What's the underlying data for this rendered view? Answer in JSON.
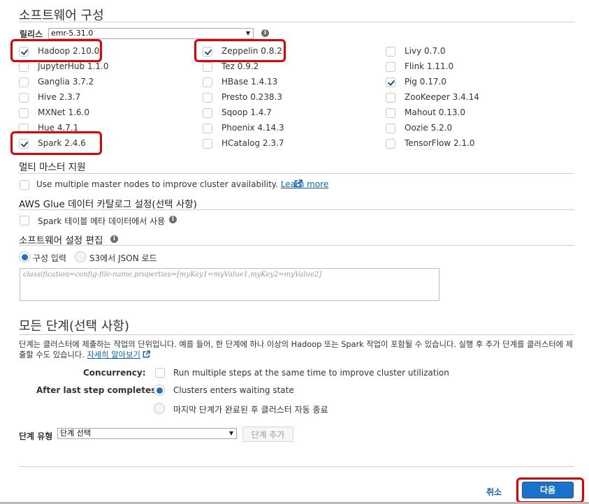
{
  "software": {
    "title": "소프트웨어 구성",
    "release_label": "릴리스",
    "release_value": "emr-5.31.0",
    "apps": [
      {
        "label": "Hadoop 2.10.0",
        "checked": true
      },
      {
        "label": "Zeppelin 0.8.2",
        "checked": true
      },
      {
        "label": "Livy 0.7.0",
        "checked": false
      },
      {
        "label": "JupyterHub 1.1.0",
        "checked": false
      },
      {
        "label": "Tez 0.9.2",
        "checked": false
      },
      {
        "label": "Flink 1.11.0",
        "checked": false
      },
      {
        "label": "Ganglia 3.7.2",
        "checked": false
      },
      {
        "label": "HBase 1.4.13",
        "checked": false
      },
      {
        "label": "Pig 0.17.0",
        "checked": true
      },
      {
        "label": "Hive 2.3.7",
        "checked": false
      },
      {
        "label": "Presto 0.238.3",
        "checked": false
      },
      {
        "label": "ZooKeeper 3.4.14",
        "checked": false
      },
      {
        "label": "MXNet 1.6.0",
        "checked": false
      },
      {
        "label": "Sqoop 1.4.7",
        "checked": false
      },
      {
        "label": "Mahout 0.13.0",
        "checked": false
      },
      {
        "label": "Hue 4.7.1",
        "checked": false
      },
      {
        "label": "Phoenix 4.14.3",
        "checked": false
      },
      {
        "label": "Oozie 5.2.0",
        "checked": false
      },
      {
        "label": "Spark 2.4.6",
        "checked": true
      },
      {
        "label": "HCatalog 2.3.7",
        "checked": false
      },
      {
        "label": "TensorFlow 2.1.0",
        "checked": false
      }
    ]
  },
  "multi_master": {
    "title": "멀티 마스터 지원",
    "checkbox_label": "Use multiple master nodes to improve cluster availability.",
    "learn_more": "Learn more"
  },
  "glue": {
    "title": "AWS Glue 데이터 카탈로그 설정(선택 사항)",
    "checkbox_label": "Spark 테이블 메타 데이터에서 사용"
  },
  "edit_config": {
    "title": "소프트웨어 설정 편집",
    "radio_enter": "구성 입력",
    "radio_s3": "S3에서 JSON 로드",
    "placeholder": "classification=config-file-name,properties=[myKey1=myValue1,myKey2=myValue2]"
  },
  "steps": {
    "title": "모든 단계(선택 사항)",
    "description": "단계는 클러스터에 제출하는 작업의 단위입니다. 예를 들어, 한 단계에 하나 이상의 Hadoop 또는 Spark 작업이 포함될 수 있습니다. 실행 후 추가 단계를 클러스터에 제출할 수도 있습니다.",
    "learn_more": "자세히 알아보기",
    "concurrency_label": "Concurrency:",
    "concurrency_option": "Run multiple steps at the same time to improve cluster utilization",
    "after_last_label": "After last step completes:",
    "option_waiting": "Clusters enters waiting state",
    "option_terminate": "마지막 단계가 완료된 후 클러스터 자동 종료",
    "step_type_label": "단계 유형",
    "step_type_value": "단계 선택",
    "add_step": "단계 추가"
  },
  "footer": {
    "cancel": "취소",
    "next": "다음"
  },
  "colors": {
    "link": "#0a64bf",
    "primary": "#1a72c9",
    "highlight": "#e80000"
  }
}
